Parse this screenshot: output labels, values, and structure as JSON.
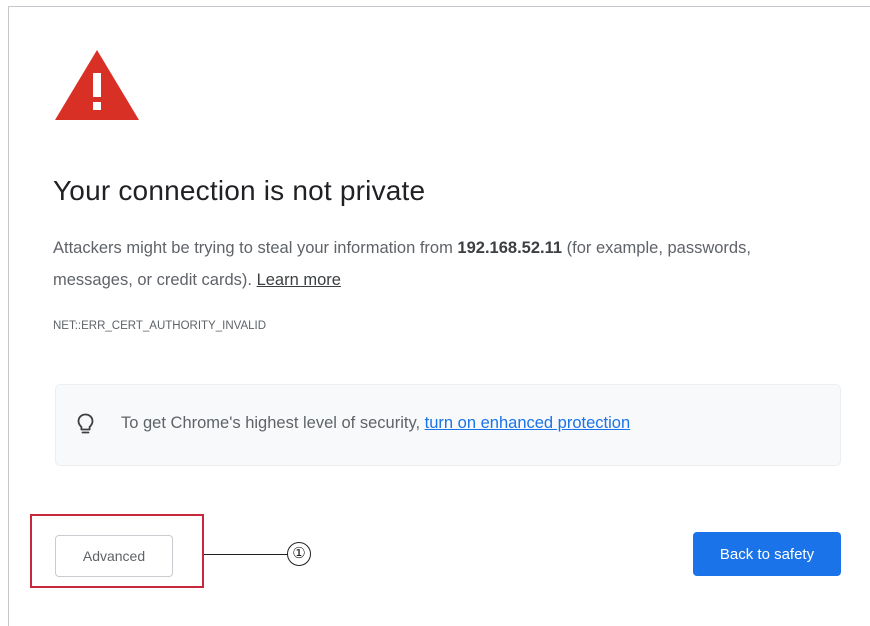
{
  "page": {
    "title": "Your connection is not private",
    "description": {
      "before_host": "Attackers might be trying to steal your information from ",
      "host": "192.168.52.11",
      "after_host": " (for example, passwords, messages, or credit cards). ",
      "learn_more": "Learn more"
    },
    "error_code": "NET::ERR_CERT_AUTHORITY_INVALID"
  },
  "enhanced_protection": {
    "text": "To get Chrome's highest level of security, ",
    "link": "turn on enhanced protection",
    "icon": "lightbulb-icon"
  },
  "buttons": {
    "advanced": "Advanced",
    "back_to_safety": "Back to safety"
  },
  "annotation": {
    "callout_number": "①"
  },
  "colors": {
    "warning_red": "#d93025",
    "primary_blue": "#1a73e8",
    "annotation_red": "#c8283c"
  },
  "icons": {
    "warning": "warning-triangle-icon",
    "bulb": "lightbulb-icon"
  }
}
